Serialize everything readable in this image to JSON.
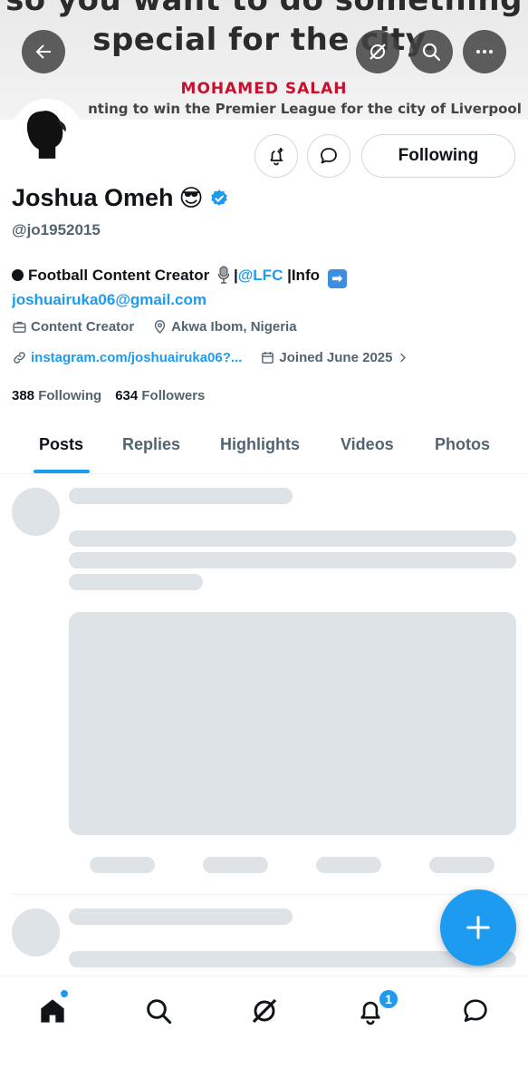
{
  "banner": {
    "headline_line1": "so you want to do something",
    "headline_line2": "special for the city.",
    "quote_author": "MOHAMED SALAH",
    "tagline": "nting to win the Premier League for the city of Liverpool"
  },
  "header_icons": {
    "back": "back-arrow-icon",
    "grok": "grok-icon",
    "search": "search-icon",
    "more": "more-icon"
  },
  "profile": {
    "display_name": "Joshua Omeh",
    "name_emoji": "😎",
    "handle": "@jo1952015",
    "verified_color": "#1d9bf0",
    "follow_label": "Following",
    "bio_text_1": "Football Content Creator",
    "bio_mention": "@LFC",
    "bio_text_2": "|Info",
    "bio_sep": "|",
    "bio_arrow": "➡",
    "email": "joshuairuka06@gmail.com",
    "category": "Content Creator",
    "location": "Akwa Ibom, Nigeria",
    "website": "instagram.com/joshuairuka06?...",
    "joined": "Joined June 2025",
    "following_count": "388",
    "following_label": "Following",
    "followers_count": "634",
    "followers_label": "Followers"
  },
  "tabs": [
    {
      "label": "Posts"
    },
    {
      "label": "Replies"
    },
    {
      "label": "Highlights"
    },
    {
      "label": "Videos"
    },
    {
      "label": "Photos"
    }
  ],
  "active_tab": "Posts",
  "bottom_nav": {
    "items": [
      "home-icon",
      "search-icon",
      "grok-icon",
      "notifications-icon",
      "messages-icon"
    ],
    "notification_count": "1"
  },
  "colors": {
    "accent": "#1d9bf0",
    "skeleton": "#dde3e7",
    "secondary_text": "#536471"
  }
}
